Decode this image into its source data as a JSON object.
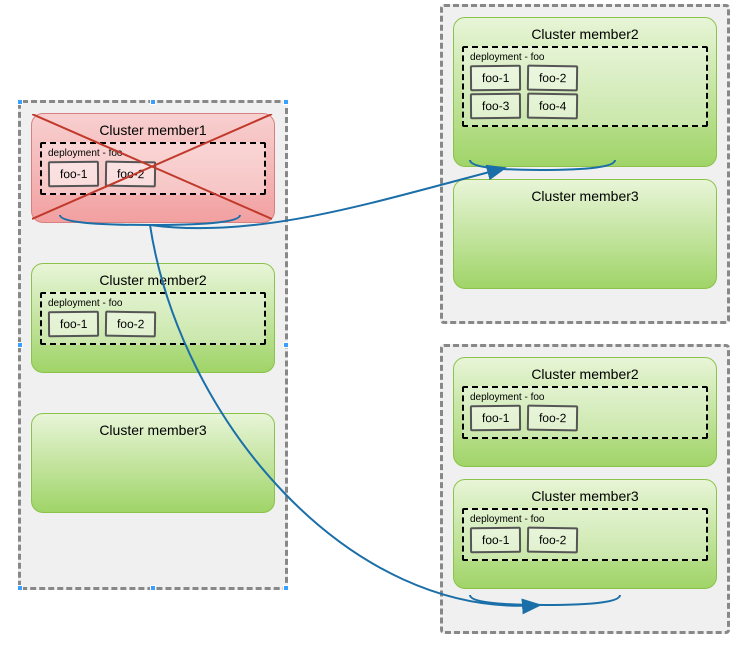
{
  "clusters": {
    "left": {
      "members": [
        {
          "title": "Cluster member1",
          "deployment_label": "deployment - foo",
          "pods": [
            "foo-1",
            "foo-2"
          ],
          "color": "red",
          "crossed_out": true
        },
        {
          "title": "Cluster member2",
          "deployment_label": "deployment - foo",
          "pods": [
            "foo-1",
            "foo-2"
          ],
          "color": "green"
        },
        {
          "title": "Cluster member3",
          "color": "green"
        }
      ]
    },
    "top_right": {
      "members": [
        {
          "title": "Cluster member2",
          "deployment_label": "deployment - foo",
          "pods": [
            "foo-1",
            "foo-2",
            "foo-3",
            "foo-4"
          ],
          "color": "green"
        },
        {
          "title": "Cluster member3",
          "color": "green"
        }
      ]
    },
    "bottom_right": {
      "members": [
        {
          "title": "Cluster member2",
          "deployment_label": "deployment - foo",
          "pods": [
            "foo-1",
            "foo-2"
          ],
          "color": "green"
        },
        {
          "title": "Cluster member3",
          "deployment_label": "deployment - foo",
          "pods": [
            "foo-1",
            "foo-2"
          ],
          "color": "green"
        }
      ]
    }
  }
}
